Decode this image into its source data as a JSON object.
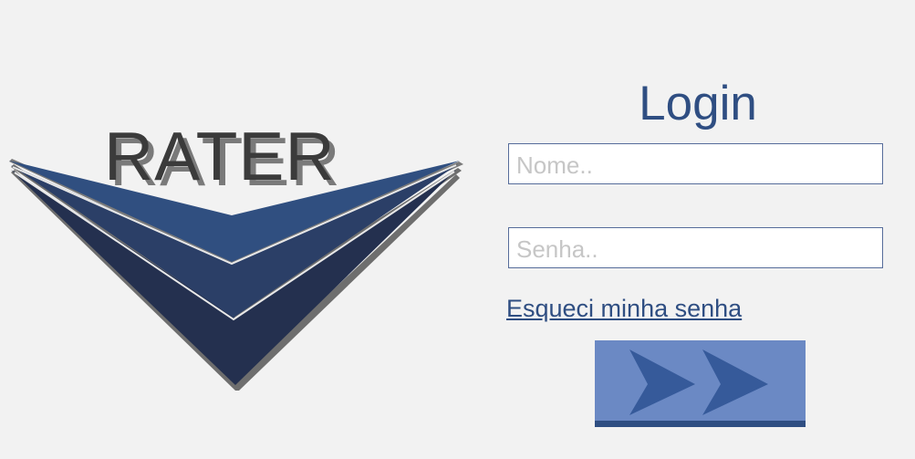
{
  "logo": {
    "text": "RATER",
    "colors": {
      "chevron_light": "#304f80",
      "chevron_mid": "#2b3f67",
      "chevron_dark": "#24304f",
      "chevron_shadow": "#6e6e6e",
      "text_fill": "#3b3b3b",
      "text_shadow": "#7a7a7a"
    }
  },
  "login": {
    "title": "Login",
    "name_placeholder": "Nome..",
    "password_placeholder": "Senha..",
    "forgot_link": "Esqueci minha senha",
    "submit_icon": "double-chevron-right-icon",
    "colors": {
      "accent": "#2f4e82",
      "button_bg": "#6b89c4",
      "button_border": "#2f4e82"
    }
  }
}
